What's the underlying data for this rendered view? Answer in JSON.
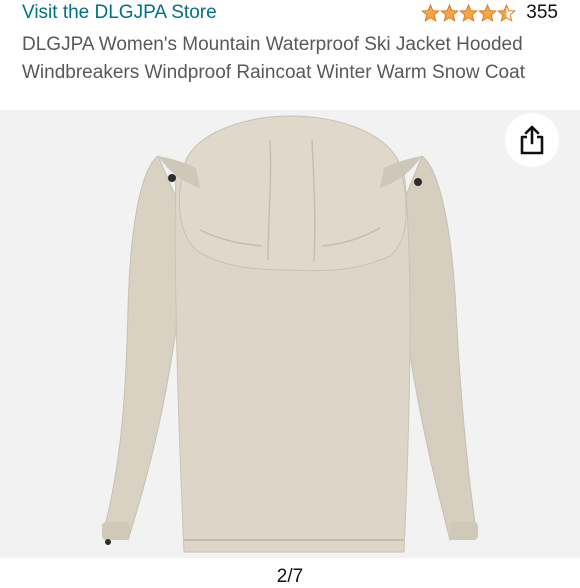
{
  "store": {
    "link_label": "Visit the DLGJPA Store"
  },
  "rating": {
    "stars": 4.5,
    "count": "355",
    "star_color": "#f3a847"
  },
  "product": {
    "title": "DLGJPA Women's Mountain Waterproof Ski Jacket Hooded Windbreakers Windproof Raincoat Winter Warm Snow Coat"
  },
  "gallery": {
    "image_name": "beige-hooded-ski-jacket",
    "share_icon": "share-icon",
    "page_indicator": "2/7"
  },
  "colors": {
    "link": "#007185",
    "jacket": "#ddd6c8",
    "lining": "#4a4a3c"
  }
}
